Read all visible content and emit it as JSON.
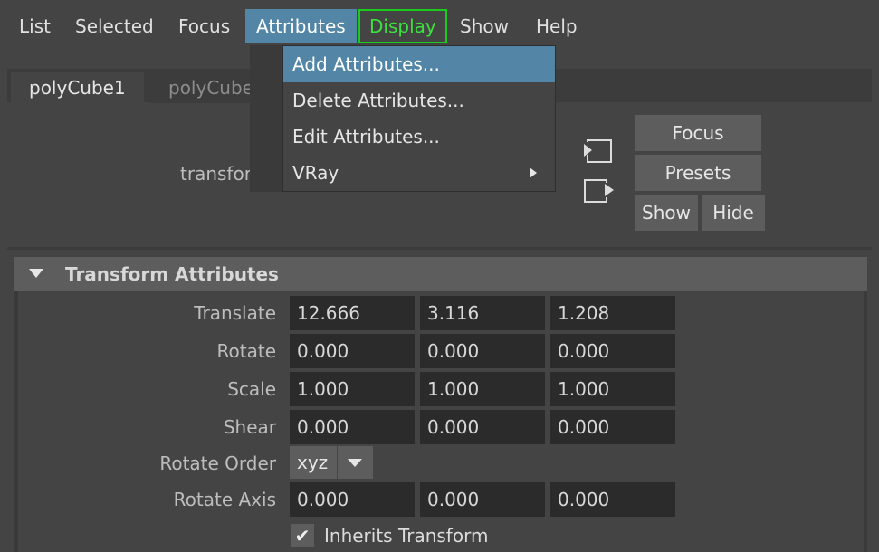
{
  "menubar": {
    "items": [
      "List",
      "Selected",
      "Focus",
      "Attributes",
      "Display",
      "Show",
      "Help"
    ],
    "active_index": 3
  },
  "tabs": [
    "polyCube1",
    "polyCube"
  ],
  "node_label": "transfor",
  "buttons": {
    "focus": "Focus",
    "presets": "Presets",
    "show": "Show",
    "hide": "Hide"
  },
  "attributes_menu": {
    "items": [
      "Add Attributes...",
      "Delete Attributes...",
      "Edit Attributes...",
      "VRay"
    ],
    "highlighted_index": 0,
    "submenu_index": 3
  },
  "section": {
    "title": "Transform Attributes",
    "rows": [
      {
        "label": "Translate",
        "values": [
          "12.666",
          "3.116",
          "1.208"
        ]
      },
      {
        "label": "Rotate",
        "values": [
          "0.000",
          "0.000",
          "0.000"
        ]
      },
      {
        "label": "Scale",
        "values": [
          "1.000",
          "1.000",
          "1.000"
        ]
      },
      {
        "label": "Shear",
        "values": [
          "0.000",
          "0.000",
          "0.000"
        ]
      }
    ],
    "rotate_order": {
      "label": "Rotate Order",
      "value": "xyz"
    },
    "rotate_axis": {
      "label": "Rotate Axis",
      "values": [
        "0.000",
        "0.000",
        "0.000"
      ]
    },
    "inherits_transform": {
      "label": "Inherits Transform",
      "checked": true,
      "mark": "✔"
    }
  },
  "colors": {
    "accent": "#5285a6",
    "display_outline": "#1ccc1c",
    "background": "#444444",
    "field": "#2b2b2b"
  }
}
